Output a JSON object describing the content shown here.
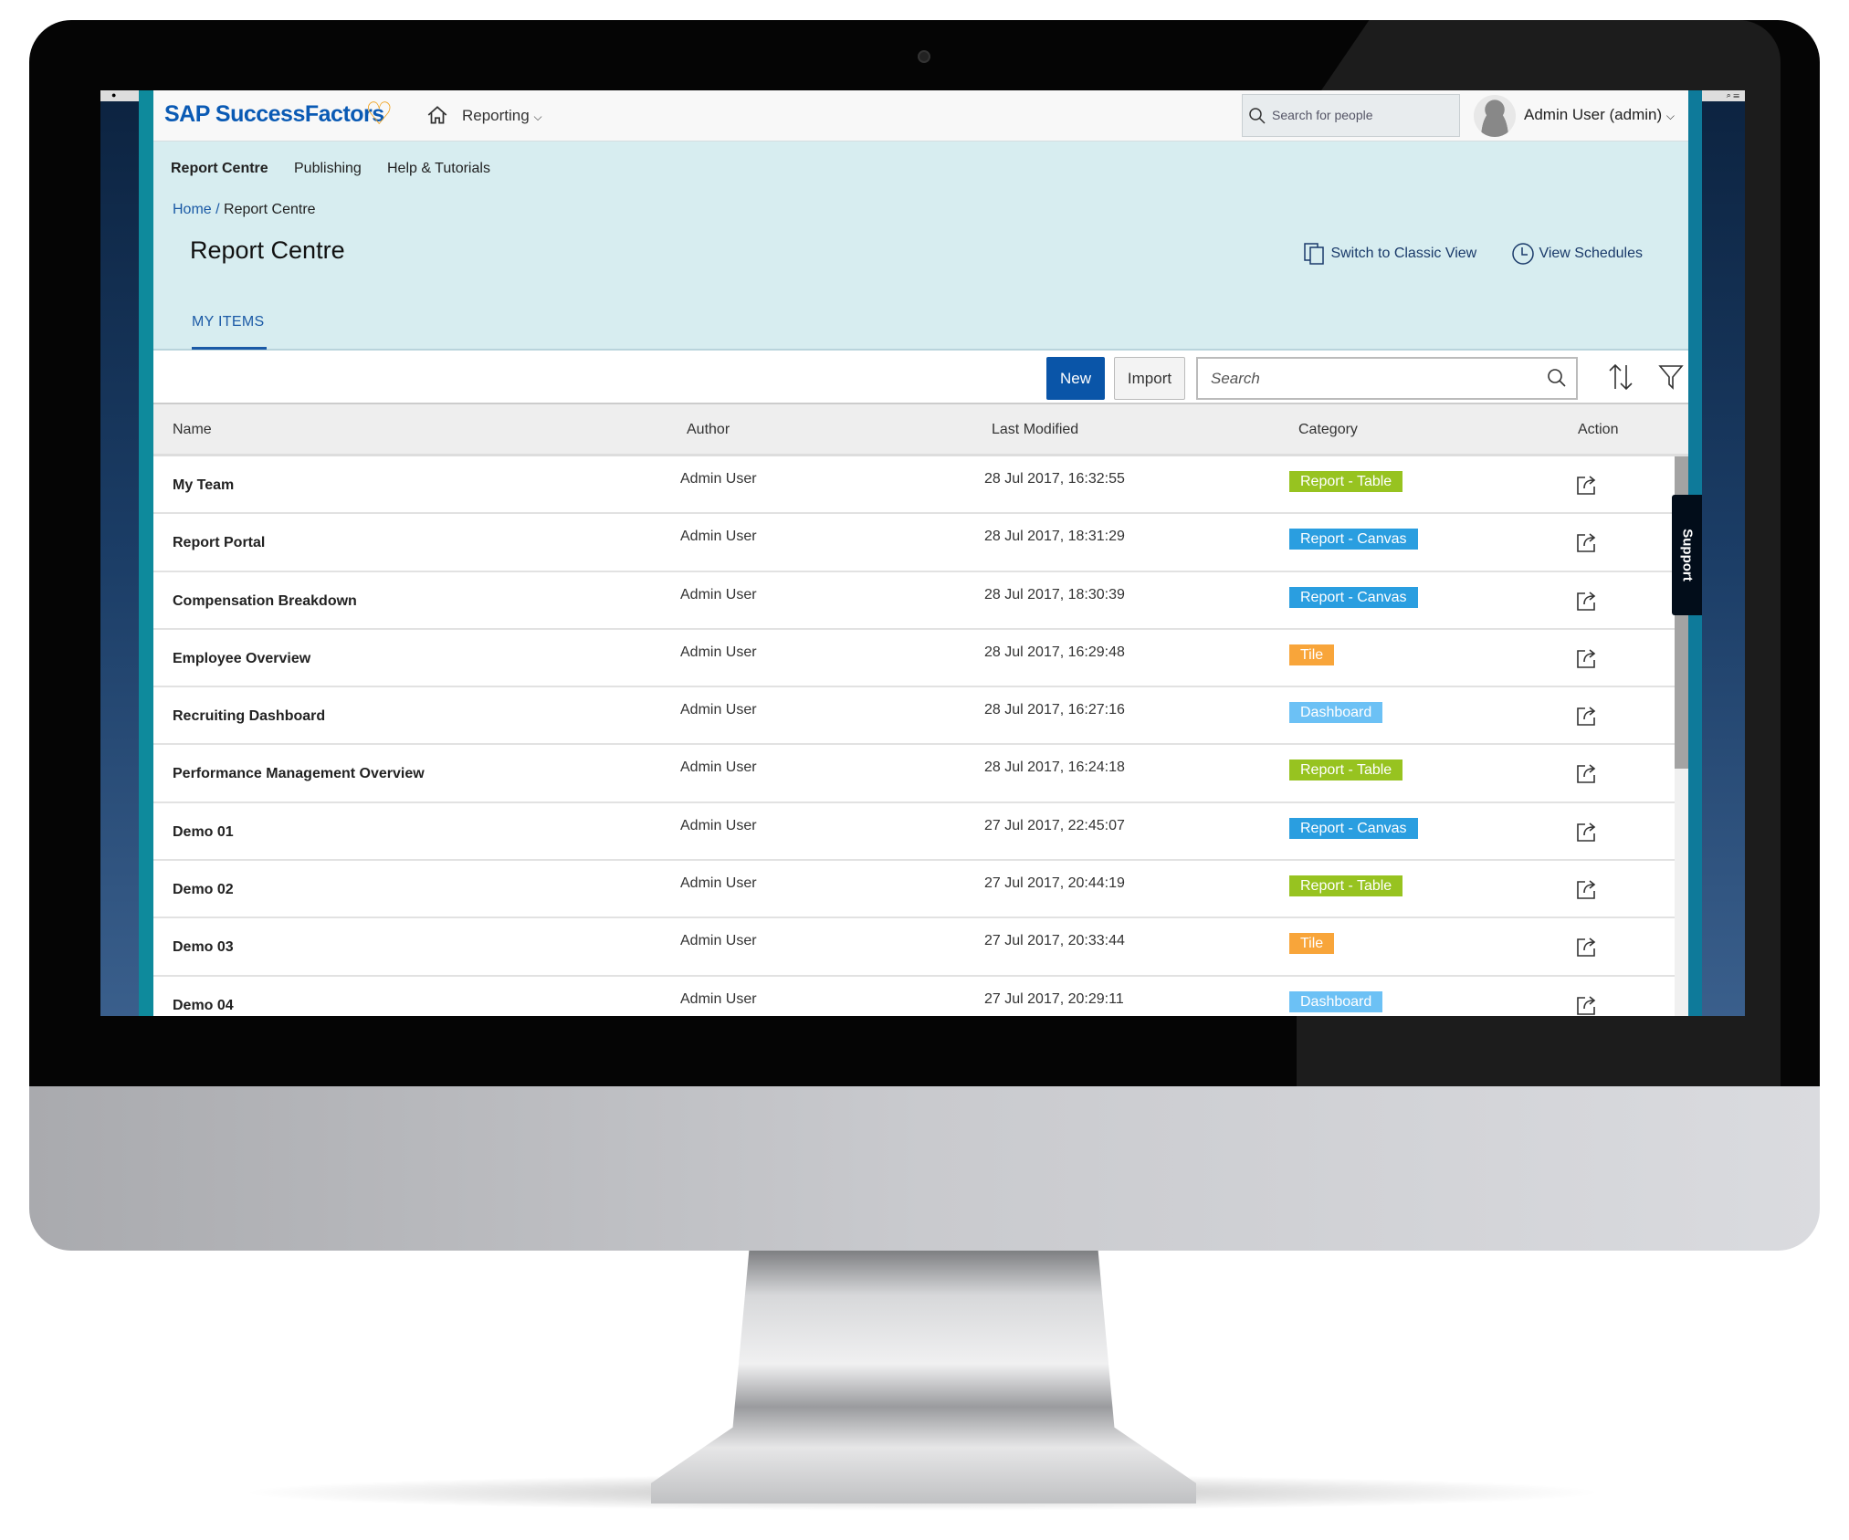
{
  "app": {
    "brand": "SAP SuccessFactors",
    "module_menu": "Reporting",
    "people_search_placeholder": "Search for people",
    "user_menu": "Admin User (admin)"
  },
  "subnav": {
    "items": [
      "Report Centre",
      "Publishing",
      "Help & Tutorials"
    ],
    "active": "Report Centre"
  },
  "breadcrumb": {
    "home": "Home",
    "separator": "/",
    "current": "Report Centre"
  },
  "page": {
    "title": "Report Centre",
    "switch_classic": "Switch to Classic View",
    "view_schedules": "View Schedules",
    "tab": "MY ITEMS"
  },
  "toolbar": {
    "new_label": "New",
    "import_label": "Import",
    "search_placeholder": "Search"
  },
  "table": {
    "columns": [
      "Name",
      "Author",
      "Last Modified",
      "Category",
      "Action"
    ],
    "rows": [
      {
        "name": "My Team",
        "author": "Admin User",
        "modified": "28 Jul 2017, 16:32:55",
        "category": "Report - Table"
      },
      {
        "name": "Report Portal",
        "author": "Admin User",
        "modified": "28 Jul 2017, 18:31:29",
        "category": "Report - Canvas"
      },
      {
        "name": "Compensation Breakdown",
        "author": "Admin User",
        "modified": "28 Jul 2017, 18:30:39",
        "category": "Report - Canvas"
      },
      {
        "name": "Employee Overview",
        "author": "Admin User",
        "modified": "28 Jul 2017, 16:29:48",
        "category": "Tile"
      },
      {
        "name": "Recruiting Dashboard",
        "author": "Admin User",
        "modified": "28 Jul 2017, 16:27:16",
        "category": "Dashboard"
      },
      {
        "name": "Performance Management Overview",
        "author": "Admin User",
        "modified": "28 Jul 2017, 16:24:18",
        "category": "Report - Table"
      },
      {
        "name": "Demo 01",
        "author": "Admin User",
        "modified": "27 Jul 2017, 22:45:07",
        "category": "Report - Canvas"
      },
      {
        "name": "Demo 02",
        "author": "Admin User",
        "modified": "27 Jul 2017, 20:44:19",
        "category": "Report - Table"
      },
      {
        "name": "Demo 03",
        "author": "Admin User",
        "modified": "27 Jul 2017, 20:33:44",
        "category": "Tile"
      },
      {
        "name": "Demo 04",
        "author": "Admin User",
        "modified": "27 Jul 2017, 20:29:11",
        "category": "Dashboard"
      }
    ]
  },
  "category_colors": {
    "Report - Table": "#97c320",
    "Report - Canvas": "#2a9ee0",
    "Tile": "#f8a53a",
    "Dashboard": "#6cc1f5"
  },
  "support_tab": "Support",
  "colors": {
    "brand_blue": "#0a5ab4",
    "header_panel": "#d7edf0",
    "primary_button": "#0a55a8",
    "heart": "#f0a21e"
  }
}
